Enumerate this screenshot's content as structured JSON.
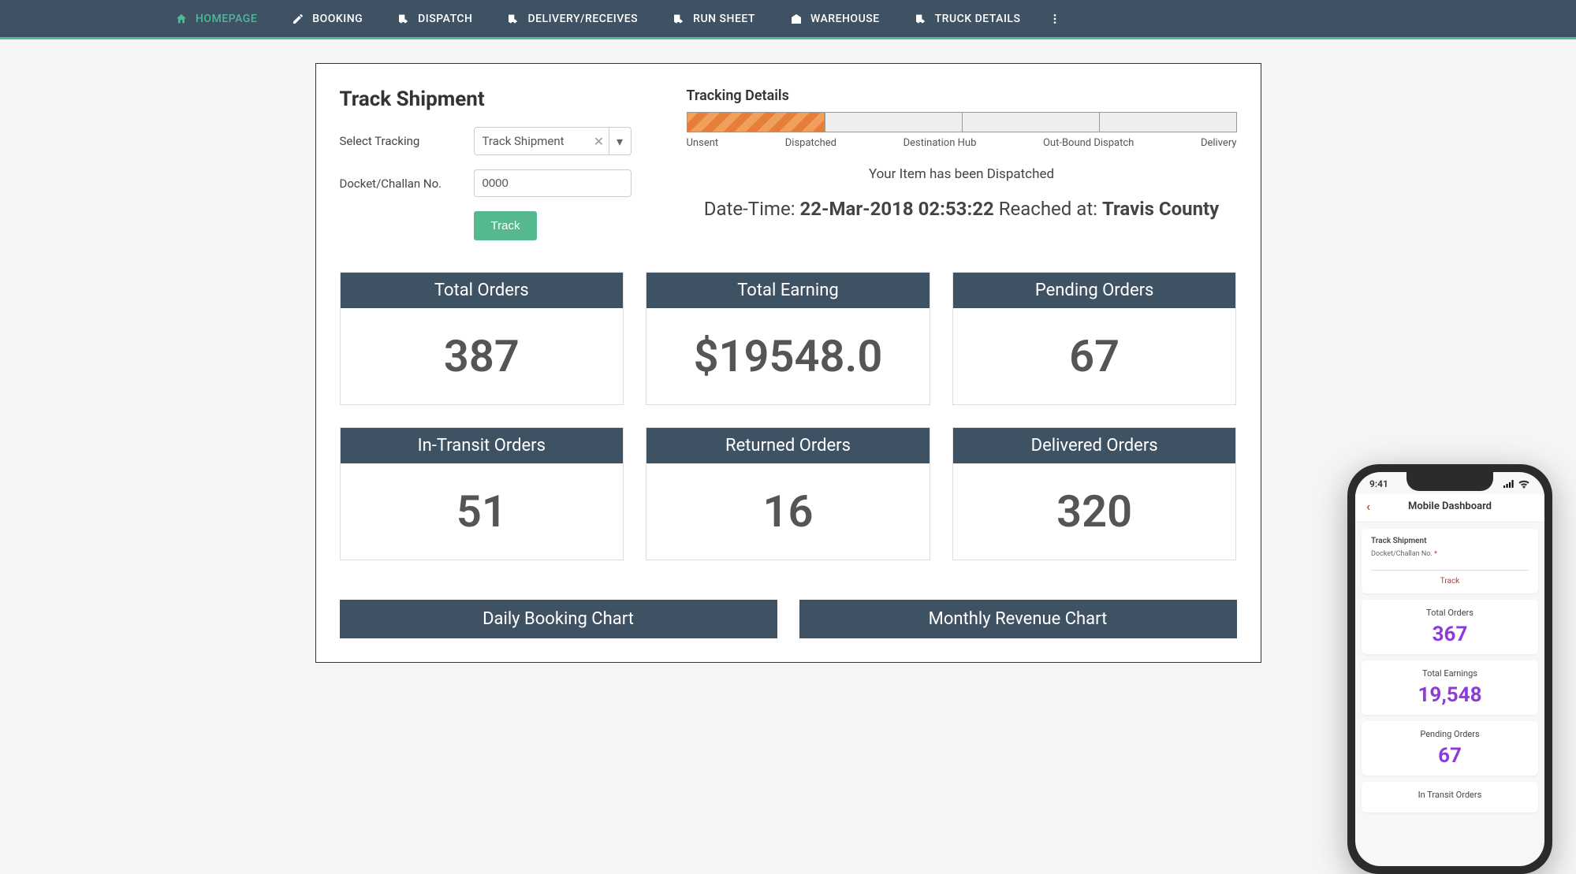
{
  "nav": {
    "items": [
      {
        "label": "HOMEPAGE",
        "active": true
      },
      {
        "label": "BOOKING"
      },
      {
        "label": "DISPATCH"
      },
      {
        "label": "DELIVERY/RECEIVES"
      },
      {
        "label": "RUN SHEET"
      },
      {
        "label": "WAREHOUSE"
      },
      {
        "label": "TRUCK DETAILS"
      }
    ]
  },
  "track": {
    "title": "Track Shipment",
    "select_label": "Select Tracking",
    "select_value": "Track Shipment",
    "docket_label": "Docket/Challan No.",
    "docket_value": "0000",
    "button": "Track"
  },
  "tracking_details": {
    "title": "Tracking Details",
    "stages": [
      "Unsent",
      "Dispatched",
      "Destination Hub",
      "Out-Bound Dispatch",
      "Delivery"
    ],
    "status_msg": "Your Item has been Dispatched",
    "dt_label": "Date-Time: ",
    "dt_value": "22-Mar-2018 02:53:22",
    "reached_label": " Reached at: ",
    "reached_value": "Travis County"
  },
  "stats": [
    {
      "label": "Total Orders",
      "value": "387"
    },
    {
      "label": "Total Earning",
      "value": "$19548.0"
    },
    {
      "label": "Pending Orders",
      "value": "67"
    },
    {
      "label": "In-Transit Orders",
      "value": "51"
    },
    {
      "label": "Returned Orders",
      "value": "16"
    },
    {
      "label": "Delivered Orders",
      "value": "320"
    }
  ],
  "charts": {
    "daily": "Daily Booking Chart",
    "monthly": "Monthly Revenue Chart"
  },
  "mobile": {
    "time": "9:41",
    "title": "Mobile Dashboard",
    "track_title": "Track Shipment",
    "docket_label": "Docket/Challan No.",
    "required_mark": "*",
    "track_btn": "Track",
    "cards": [
      {
        "label": "Total Orders",
        "value": "367"
      },
      {
        "label": "Total Earnings",
        "value": "19,548"
      },
      {
        "label": "Pending Orders",
        "value": "67"
      },
      {
        "label": "In Transit Orders",
        "value": ""
      }
    ]
  }
}
